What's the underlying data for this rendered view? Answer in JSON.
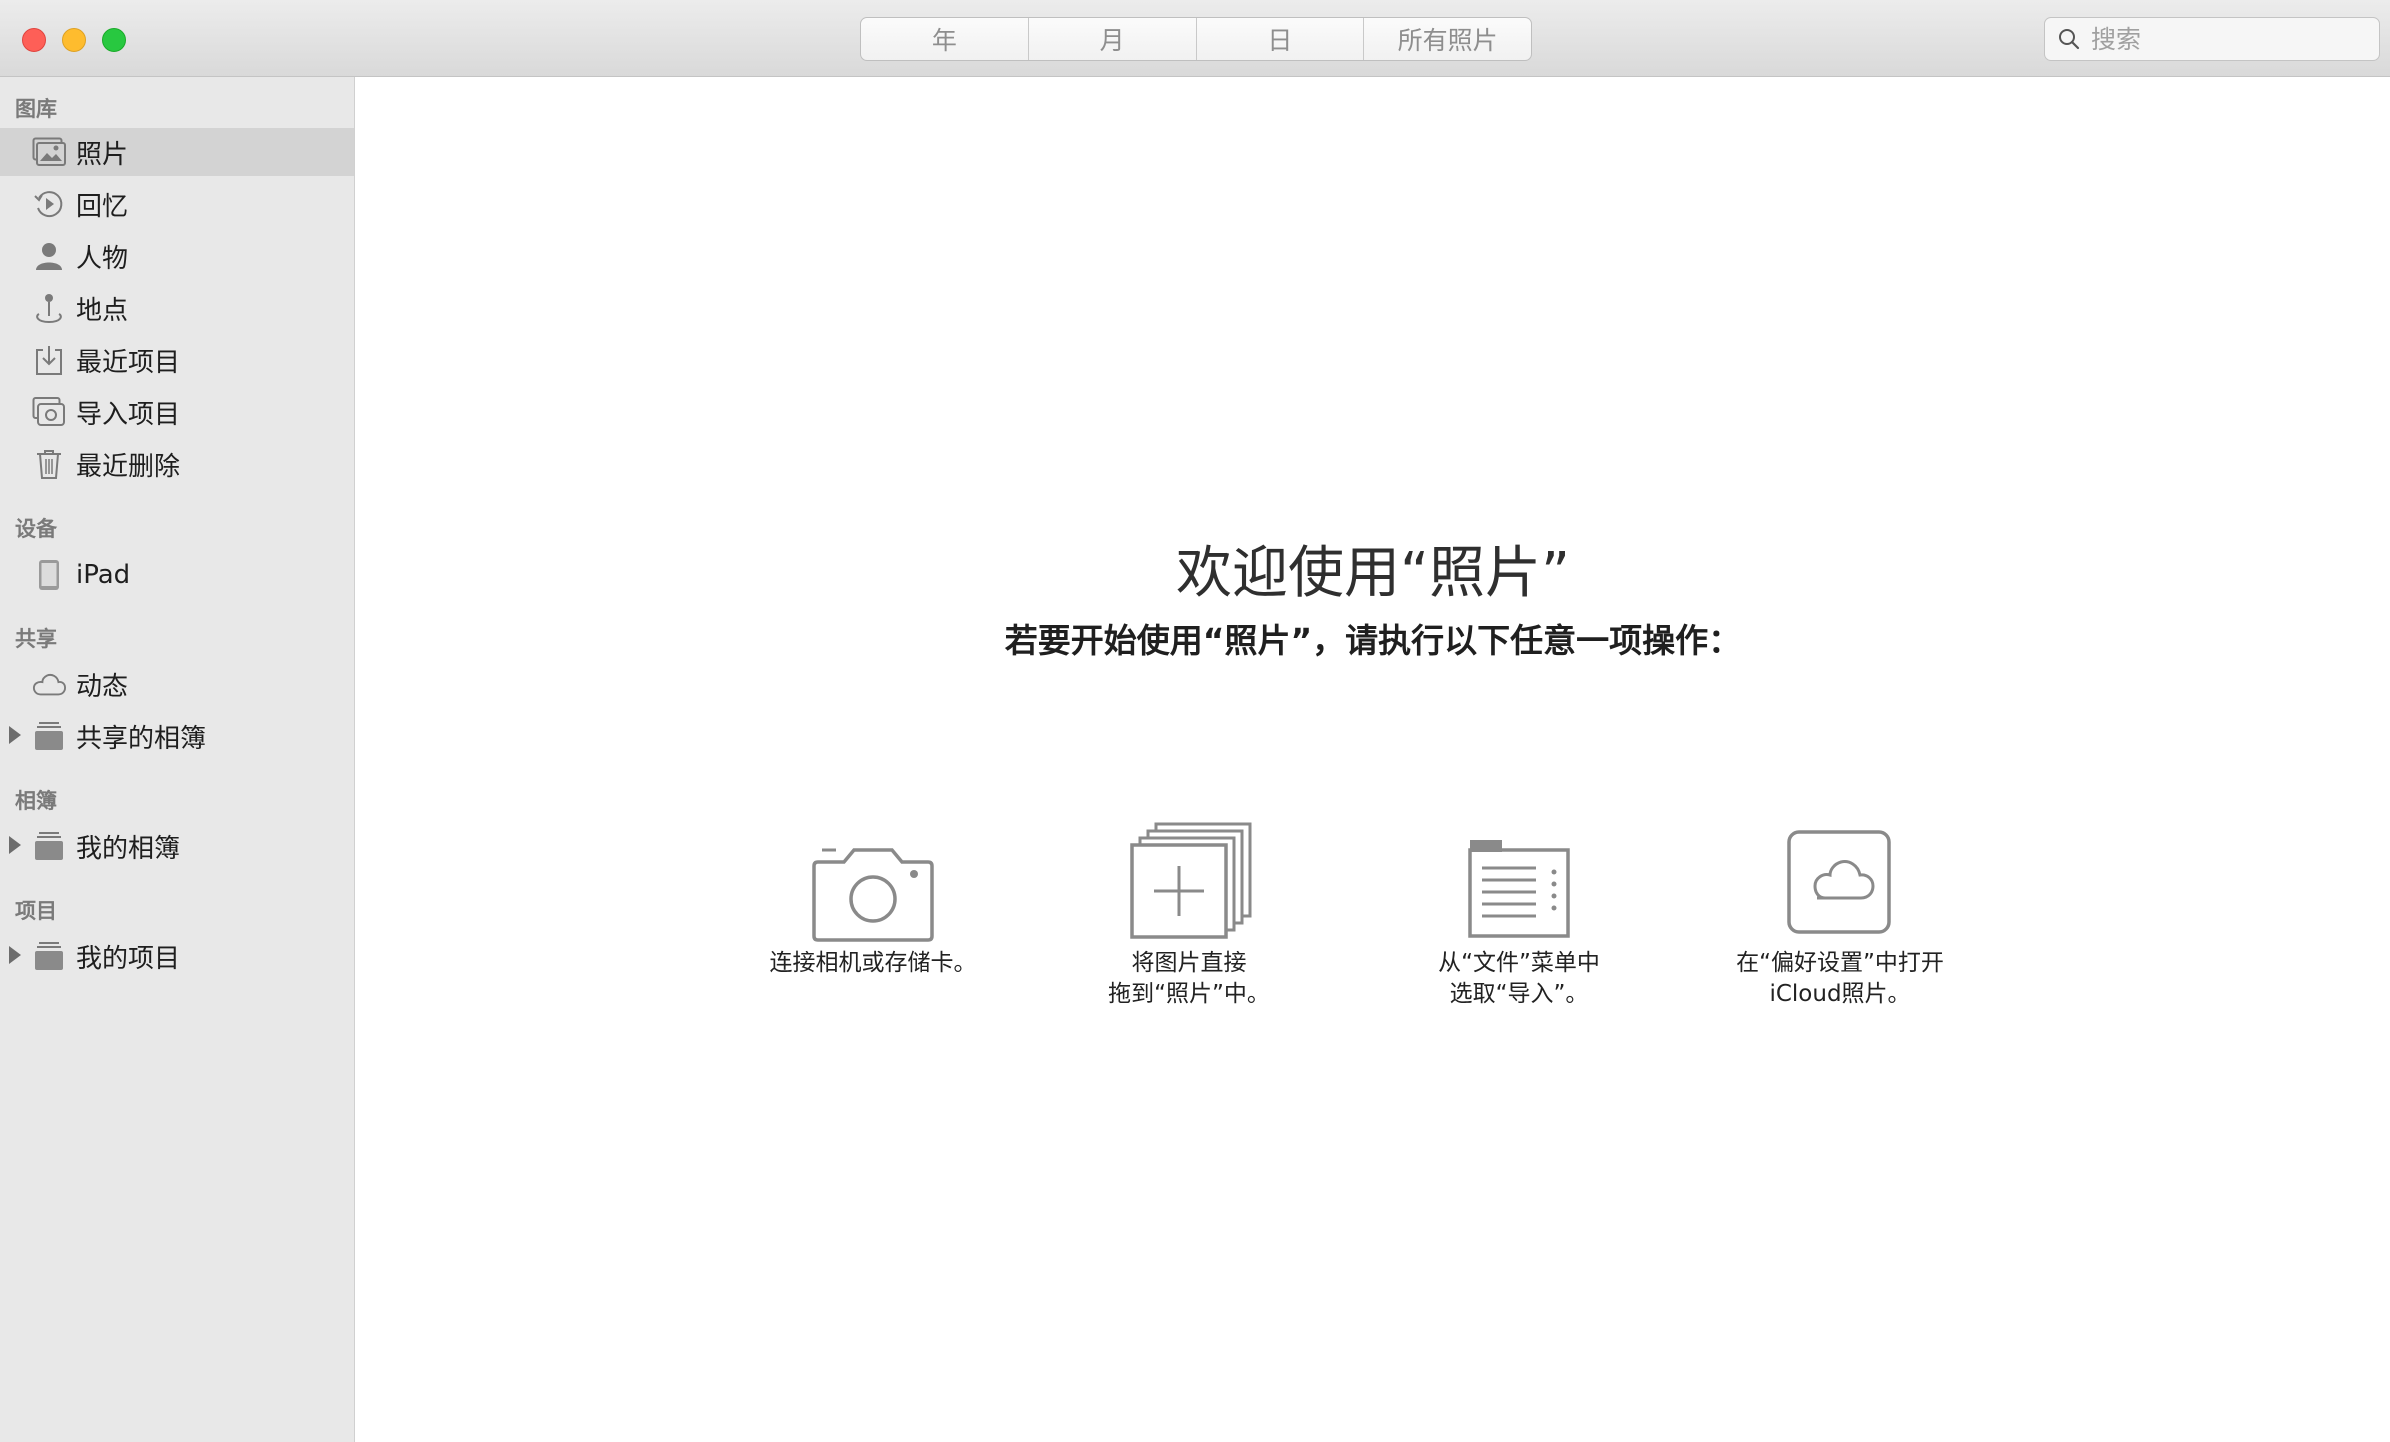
{
  "toolbar": {
    "segments": [
      "年",
      "月",
      "日",
      "所有照片"
    ],
    "search_placeholder": "搜索"
  },
  "sidebar": {
    "library": {
      "header": "图库",
      "items": [
        "照片",
        "回忆",
        "人物",
        "地点",
        "最近项目",
        "导入项目",
        "最近删除"
      ]
    },
    "devices": {
      "header": "设备",
      "items": [
        "iPad"
      ]
    },
    "shared": {
      "header": "共享",
      "items": [
        "动态",
        "共享的相簿"
      ]
    },
    "albums": {
      "header": "相簿",
      "items": [
        "我的相簿"
      ]
    },
    "projects": {
      "header": "项目",
      "items": [
        "我的项目"
      ]
    }
  },
  "main": {
    "title": "欢迎使用“照片”",
    "subtitle": "若要开始使用“照片”，请执行以下任意一项操作：",
    "options": [
      {
        "icon": "camera-icon",
        "line1": "连接相机或存储卡。",
        "line2": ""
      },
      {
        "icon": "drag-photos-icon",
        "line1": "将图片直接",
        "line2": "拖到“照片”中。"
      },
      {
        "icon": "file-menu-icon",
        "line1": "从“文件”菜单中",
        "line2": "选取“导入”。"
      },
      {
        "icon": "icloud-icon",
        "line1": "在“偏好设置”中打开",
        "line2": "iCloud照片。"
      }
    ]
  },
  "colors": {
    "close": "#fe5f57",
    "minimize": "#febc2e",
    "zoom": "#28c840",
    "sidebar_bg": "#e8e8e8",
    "selected_bg": "#d3d3d3",
    "icon_gray": "#8a8a8a"
  }
}
